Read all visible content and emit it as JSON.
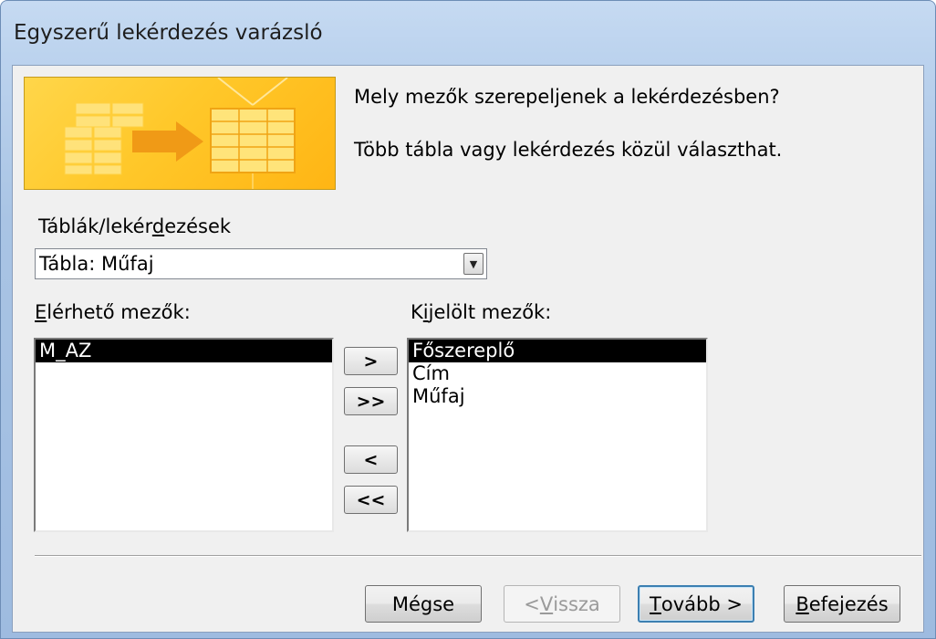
{
  "window": {
    "title": "Egyszerű lekérdezés varázsló"
  },
  "header": {
    "question": "Mely mezők szerepeljenek a lekérdezésben?",
    "hint": "Több tábla vagy lekérdezés közül választhat."
  },
  "tables": {
    "label_pre": "Táblák/lekér",
    "label_hot": "d",
    "label_post": "ezések",
    "selected": "Tábla: Műfaj",
    "dropdown_icon": "chevron-down-icon"
  },
  "available": {
    "label_hot": "E",
    "label_post": "lérhető mezők:",
    "items": [
      "M_AZ"
    ],
    "selected_index": 0
  },
  "selected_fields": {
    "label_pre": "K",
    "label_hot": "i",
    "label_post": "jelölt mezők:",
    "items": [
      "Főszereplő",
      "Cím",
      "Műfaj"
    ],
    "selected_index": 0
  },
  "move_buttons": {
    "add_one": ">",
    "add_all": ">>",
    "remove_one": "<",
    "remove_all": "<<"
  },
  "footer": {
    "cancel": "Mégse",
    "back_pre": "< ",
    "back_hot": "V",
    "back_post": "issza",
    "next_hot": "T",
    "next_post": "ovább >",
    "finish_hot": "B",
    "finish_post": "efejezés"
  },
  "colors": {
    "banner": "#ffc82a",
    "title_bar": "#c6daf2",
    "selection": "#000000",
    "default_button_border": "#3c7fb1"
  }
}
